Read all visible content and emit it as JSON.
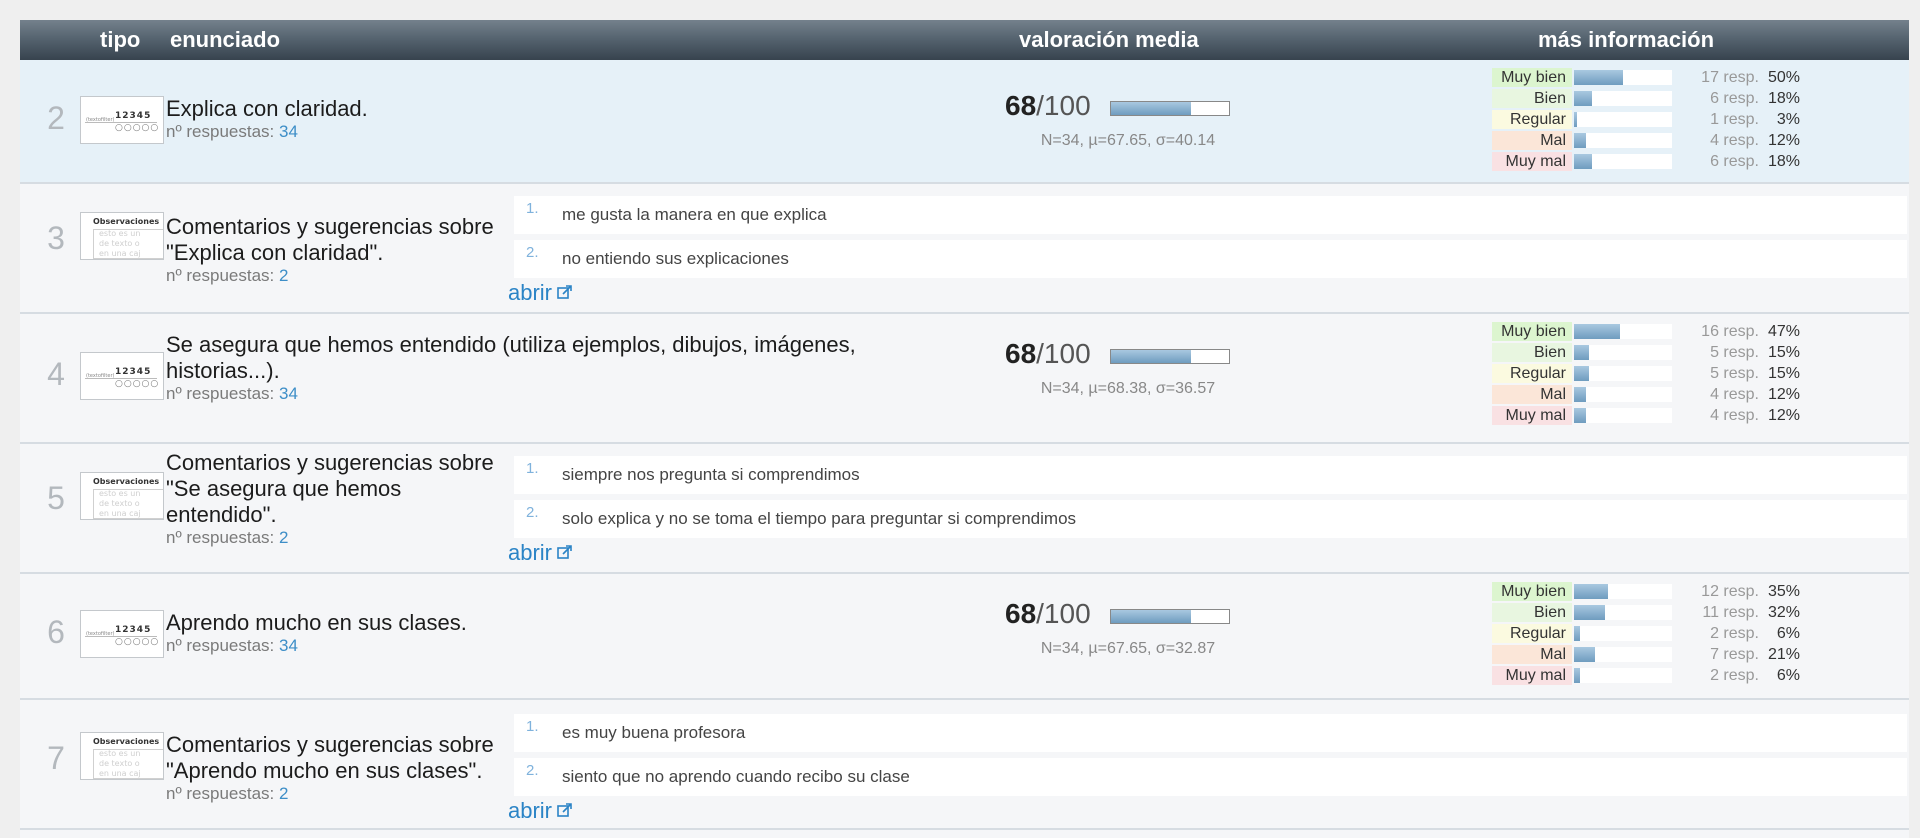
{
  "header": {
    "tipo": "tipo",
    "enunciado": "enunciado",
    "valoracion": "valoración media",
    "info": "más información"
  },
  "labels": {
    "respuestas": "nº respuestas:",
    "abrir": "abrir",
    "resp_suffix": "resp."
  },
  "colors": {
    "muy_bien": "#dcf5cf",
    "bien": "#e8f6e0",
    "regular": "#fbfae0",
    "mal": "#fbe6d8",
    "muy_mal": "#f9e1e3",
    "link": "#2b84c6",
    "bar": "#6f9cbf"
  },
  "thumbs": {
    "scale_digits": [
      "1",
      "2",
      "3",
      "4",
      "5"
    ],
    "scale_tag": "(textofilter)",
    "text_title": "Observaciones",
    "text_lines": [
      "esto es un",
      "de texto o",
      "en una caj"
    ]
  },
  "rows": [
    {
      "type": "scale",
      "num": "2",
      "enunciado": "Explica con claridad.",
      "respuestas": "34",
      "score": "68",
      "denom": "/100",
      "score_fraction": 0.68,
      "stats": "N=34, µ=67.65, σ=40.14",
      "dist": [
        {
          "label": "Muy bien",
          "resp": "17",
          "pct": "50%",
          "fraction": 0.5
        },
        {
          "label": "Bien",
          "resp": "6",
          "pct": "18%",
          "fraction": 0.18
        },
        {
          "label": "Regular",
          "resp": "1",
          "pct": "3%",
          "fraction": 0.03
        },
        {
          "label": "Mal",
          "resp": "4",
          "pct": "12%",
          "fraction": 0.12
        },
        {
          "label": "Muy mal",
          "resp": "6",
          "pct": "18%",
          "fraction": 0.18
        }
      ]
    },
    {
      "type": "text",
      "num": "3",
      "enunciado_lines": [
        "Comentarios y sugerencias sobre",
        "\"Explica con claridad\"."
      ],
      "respuestas": "2",
      "comments": [
        "me gusta la manera en que explica",
        "no entiendo sus explicaciones"
      ]
    },
    {
      "type": "scale",
      "num": "4",
      "enunciado_lines": [
        "Se asegura que hemos entendido (utiliza ejemplos, dibujos, imágenes,",
        "historias...)."
      ],
      "respuestas": "34",
      "score": "68",
      "denom": "/100",
      "score_fraction": 0.68,
      "stats": "N=34, µ=68.38, σ=36.57",
      "dist": [
        {
          "label": "Muy bien",
          "resp": "16",
          "pct": "47%",
          "fraction": 0.47
        },
        {
          "label": "Bien",
          "resp": "5",
          "pct": "15%",
          "fraction": 0.15
        },
        {
          "label": "Regular",
          "resp": "5",
          "pct": "15%",
          "fraction": 0.15
        },
        {
          "label": "Mal",
          "resp": "4",
          "pct": "12%",
          "fraction": 0.12
        },
        {
          "label": "Muy mal",
          "resp": "4",
          "pct": "12%",
          "fraction": 0.12
        }
      ]
    },
    {
      "type": "text",
      "num": "5",
      "enunciado_lines": [
        "Comentarios y sugerencias sobre",
        "\"Se asegura que hemos",
        "entendido\"."
      ],
      "respuestas": "2",
      "comments": [
        "siempre nos pregunta si comprendimos",
        "solo explica y no se toma el tiempo para preguntar si comprendimos"
      ]
    },
    {
      "type": "scale",
      "num": "6",
      "enunciado": "Aprendo mucho en sus clases.",
      "respuestas": "34",
      "score": "68",
      "denom": "/100",
      "score_fraction": 0.68,
      "stats": "N=34, µ=67.65, σ=32.87",
      "dist": [
        {
          "label": "Muy bien",
          "resp": "12",
          "pct": "35%",
          "fraction": 0.35
        },
        {
          "label": "Bien",
          "resp": "11",
          "pct": "32%",
          "fraction": 0.32
        },
        {
          "label": "Regular",
          "resp": "2",
          "pct": "6%",
          "fraction": 0.06
        },
        {
          "label": "Mal",
          "resp": "7",
          "pct": "21%",
          "fraction": 0.21
        },
        {
          "label": "Muy mal",
          "resp": "2",
          "pct": "6%",
          "fraction": 0.06
        }
      ]
    },
    {
      "type": "text",
      "num": "7",
      "enunciado_lines": [
        "Comentarios y sugerencias sobre",
        "\"Aprendo mucho en sus clases\"."
      ],
      "respuestas": "2",
      "comments": [
        "es muy buena profesora",
        "siento que no aprendo cuando recibo su clase"
      ]
    }
  ]
}
